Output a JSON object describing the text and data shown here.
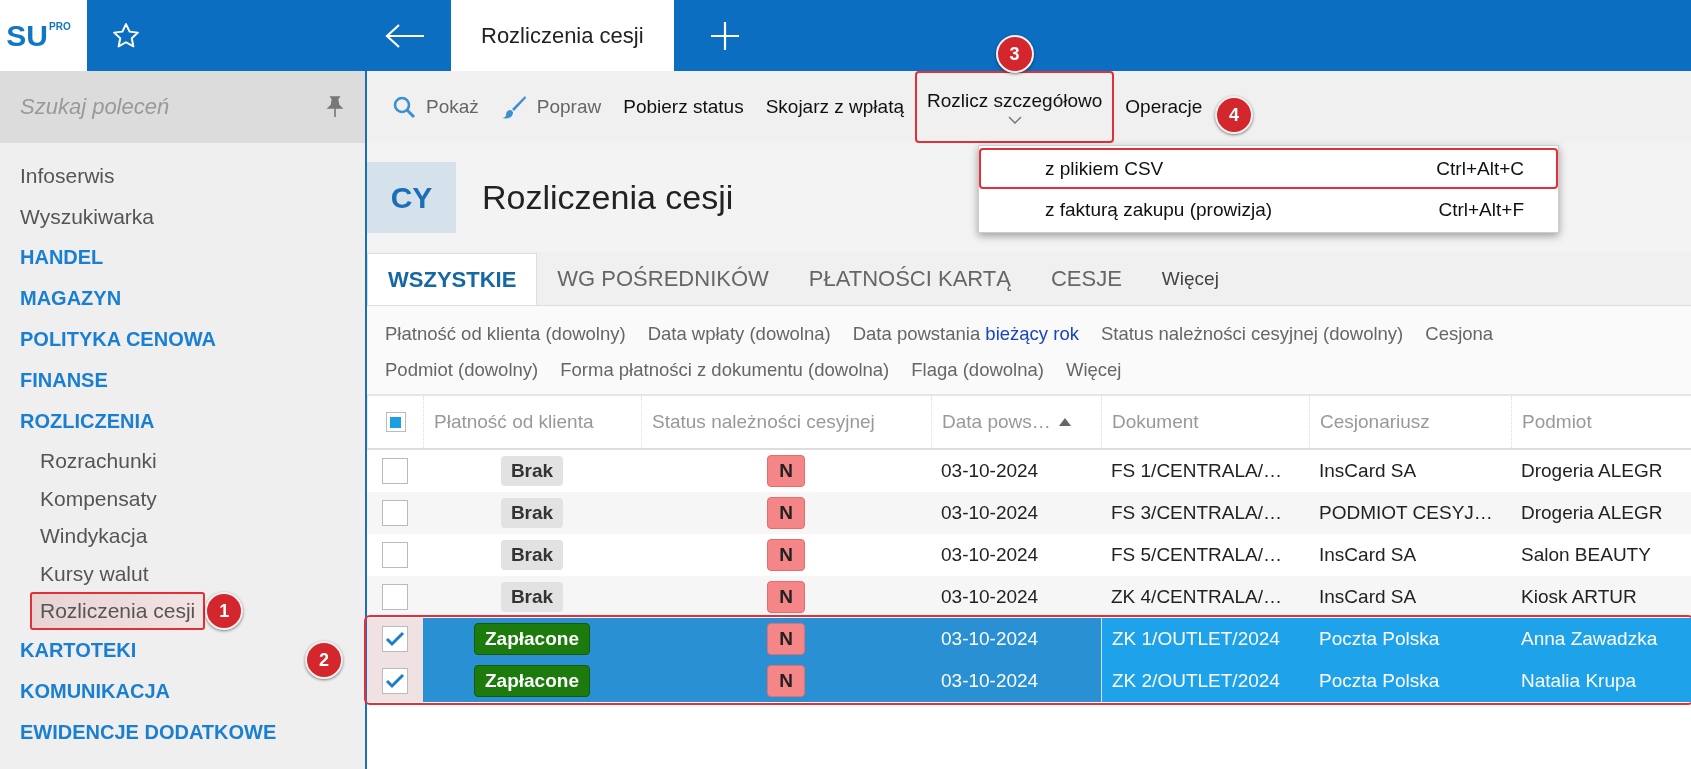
{
  "app": {
    "logo": "SU",
    "logo_badge": "PRO"
  },
  "top_tabs": [
    {
      "label": "Rozliczenia cesji",
      "selected": true
    }
  ],
  "sidebar": {
    "search_placeholder": "Szukaj poleceń",
    "items": [
      {
        "label": "Infoserwis",
        "kind": "link"
      },
      {
        "label": "Wyszukiwarka",
        "kind": "link"
      },
      {
        "label": "HANDEL",
        "kind": "section"
      },
      {
        "label": "MAGAZYN",
        "kind": "section"
      },
      {
        "label": "POLITYKA CENOWA",
        "kind": "section"
      },
      {
        "label": "FINANSE",
        "kind": "section"
      },
      {
        "label": "ROZLICZENIA",
        "kind": "section",
        "children": [
          {
            "label": "Rozrachunki",
            "kind": "link",
            "selected": false
          },
          {
            "label": "Kompensaty",
            "kind": "link",
            "selected": false
          },
          {
            "label": "Windykacja",
            "kind": "link",
            "selected": false
          },
          {
            "label": "Kursy walut",
            "kind": "link",
            "selected": false
          },
          {
            "label": "Rozliczenia cesji",
            "kind": "link",
            "selected": true,
            "annotation": "1"
          }
        ]
      },
      {
        "label": "KARTOTEKI",
        "kind": "section"
      },
      {
        "label": "KOMUNIKACJA",
        "kind": "section"
      },
      {
        "label": "EWIDENCJE DODATKOWE",
        "kind": "section"
      }
    ]
  },
  "toolbar": [
    {
      "label": "Pokaż",
      "kind": "search",
      "disabled": true
    },
    {
      "label": "Popraw",
      "kind": "brush",
      "disabled": true
    },
    {
      "label": "Pobierz status",
      "kind": "plain",
      "disabled": false
    },
    {
      "label": "Skojarz z wpłatą",
      "kind": "plain",
      "disabled": false
    },
    {
      "label": "Rozlicz szczegółowo",
      "kind": "dropdown",
      "disabled": false,
      "expanded": true,
      "annotation": "3"
    },
    {
      "label": "Operacje",
      "kind": "plain",
      "disabled": false
    }
  ],
  "dropdown_menu": [
    {
      "label": "z plikiem CSV",
      "shortcut": "Ctrl+Alt+C",
      "annotation": "4"
    },
    {
      "label": "z fakturą zakupu (prowizja)",
      "shortcut": "Ctrl+Alt+F"
    }
  ],
  "page": {
    "code": "CY",
    "title": "Rozliczenia cesji"
  },
  "tabs": [
    {
      "label": "WSZYSTKIE",
      "selected": true
    },
    {
      "label": "WG POŚREDNIKÓW",
      "selected": false
    },
    {
      "label": "PŁATNOŚCI KARTĄ",
      "selected": false
    },
    {
      "label": "CESJE",
      "selected": false
    }
  ],
  "tabs_more": "Więcej",
  "filter_rows": [
    [
      {
        "label": "Płatność od klienta",
        "value": "(dowolny)",
        "set": false
      },
      {
        "label": "Data wpłaty",
        "value": "(dowolna)",
        "set": false
      },
      {
        "label": "Data powstania",
        "value": "bieżący rok",
        "set": true
      },
      {
        "label": "Status należności cesyjnej",
        "value": "(dowolny)",
        "set": false
      },
      {
        "label": "Cesjona"
      }
    ],
    [
      {
        "label": "Podmiot",
        "value": "(dowolny)",
        "set": false
      },
      {
        "label": "Forma płatności z dokumentu",
        "value": "(dowolna)",
        "set": false
      },
      {
        "label": "Flaga",
        "value": "(dowolna)",
        "set": false
      },
      {
        "label": "Więcej"
      }
    ]
  ],
  "table": {
    "select_all": {
      "indeterminate": true
    },
    "selected_rows_annotation": "2",
    "columns": [
      {
        "label": "Płatność od klienta"
      },
      {
        "label": "Status należności cesyjnej"
      },
      {
        "label": "Data pows…",
        "sorted": true
      },
      {
        "label": "Dokument"
      },
      {
        "label": "Cesjonariusz"
      },
      {
        "label": "Podmiot"
      }
    ],
    "rows": [
      {
        "selected": false,
        "checked": false,
        "payment": {
          "text": "Brak",
          "kind": "none"
        },
        "status": "N",
        "date": "03-10-2024",
        "document": "FS 1/CENTRALA/…",
        "assignee": "InsCard SA",
        "entity": "Drogeria ALEGR"
      },
      {
        "selected": false,
        "checked": false,
        "payment": {
          "text": "Brak",
          "kind": "none"
        },
        "status": "N",
        "date": "03-10-2024",
        "document": "FS 3/CENTRALA/…",
        "assignee": "PODMIOT CESYJ…",
        "entity": "Drogeria ALEGR"
      },
      {
        "selected": false,
        "checked": false,
        "payment": {
          "text": "Brak",
          "kind": "none"
        },
        "status": "N",
        "date": "03-10-2024",
        "document": "FS 5/CENTRALA/…",
        "assignee": "InsCard SA",
        "entity": "Salon BEAUTY"
      },
      {
        "selected": false,
        "checked": false,
        "payment": {
          "text": "Brak",
          "kind": "none"
        },
        "status": "N",
        "date": "03-10-2024",
        "document": "ZK 4/CENTRALA/…",
        "assignee": "InsCard SA",
        "entity": "Kiosk ARTUR"
      },
      {
        "selected": true,
        "checked": true,
        "payment": {
          "text": "Zapłacone",
          "kind": "paid"
        },
        "status": "N",
        "date": "03-10-2024",
        "document": "ZK 1/OUTLET/2024",
        "assignee": "Poczta Polska",
        "entity": "Anna Zawadzka"
      },
      {
        "selected": true,
        "checked": true,
        "payment": {
          "text": "Zapłacone",
          "kind": "paid"
        },
        "status": "N",
        "date": "03-10-2024",
        "document": "ZK 2/OUTLET/2024",
        "assignee": "Poczta Polska",
        "entity": "Natalia Krupa"
      }
    ]
  }
}
